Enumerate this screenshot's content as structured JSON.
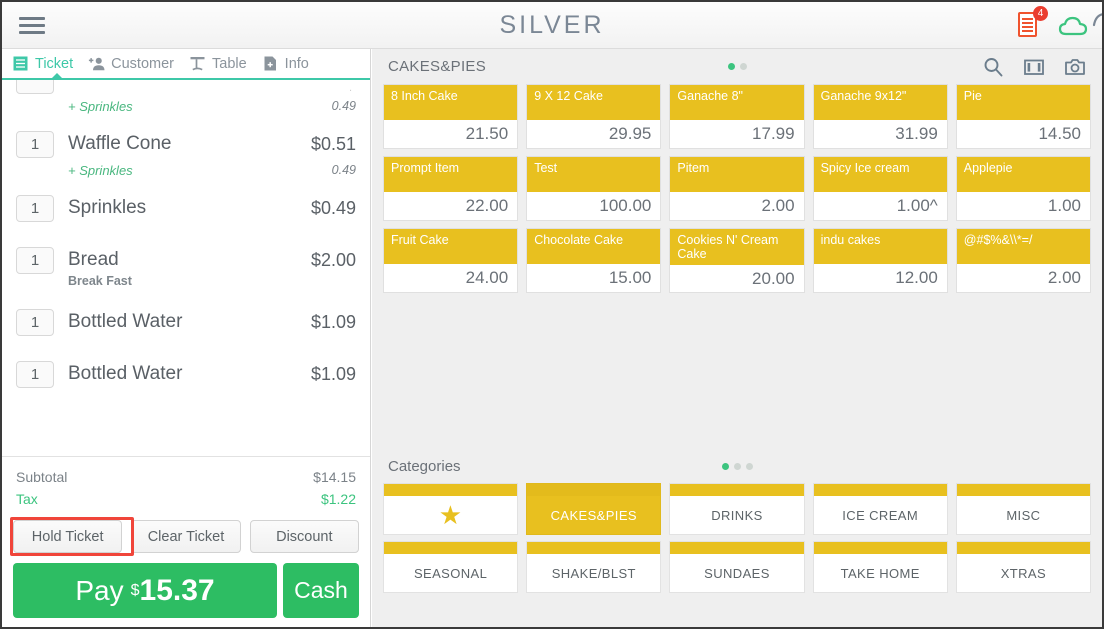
{
  "header": {
    "menu_icon": "hamburger-icon",
    "brand": "SILVER",
    "receipt_icon": "receipt-icon",
    "receipt_badge": "4",
    "cloud_icon": "cloud-icon",
    "accent_red": "#f0532e",
    "accent_green": "#3cc47f"
  },
  "ticket_panel": {
    "tabs": [
      {
        "label": "Ticket",
        "icon": "ticket-icon",
        "active": true
      },
      {
        "label": "Customer",
        "icon": "add-person-icon",
        "active": false
      },
      {
        "label": "Table",
        "icon": "table-icon",
        "active": false
      },
      {
        "label": "Info",
        "icon": "add-file-icon",
        "active": false
      }
    ],
    "clipped_modifier": {
      "name": "+ Sprinkles",
      "price": "0.49"
    },
    "items": [
      {
        "qty": "1",
        "name": "Waffle Cone",
        "price": "$0.51",
        "modifier": {
          "name": "+ Sprinkles",
          "price": "0.49"
        }
      },
      {
        "qty": "1",
        "name": "Sprinkles",
        "price": "$0.49"
      },
      {
        "qty": "1",
        "name": "Bread",
        "price": "$2.00",
        "sublabel": "Break Fast"
      },
      {
        "qty": "1",
        "name": "Bottled Water",
        "price": "$1.09"
      },
      {
        "qty": "1",
        "name": "Bottled Water",
        "price": "$1.09"
      }
    ],
    "totals": [
      {
        "label": "Subtotal",
        "value": "$14.15",
        "type": "subtotal"
      },
      {
        "label": "Tax",
        "value": "$1.22",
        "type": "tax"
      }
    ],
    "actions": [
      {
        "label": "Hold Ticket",
        "highlighted": true
      },
      {
        "label": "Clear Ticket",
        "highlighted": false
      },
      {
        "label": "Discount",
        "highlighted": false
      }
    ],
    "pay": {
      "label": "Pay",
      "currency": "$",
      "amount": "15.37"
    },
    "cash": {
      "label": "Cash"
    }
  },
  "product_grid": {
    "title": "CAKES&PIES",
    "pagination": {
      "count": 2,
      "active": 0
    },
    "icons": [
      {
        "name": "search-icon"
      },
      {
        "name": "columns-view-icon"
      },
      {
        "name": "camera-icon"
      }
    ],
    "tiles": [
      {
        "name": "8 Inch Cake",
        "price": "21.50"
      },
      {
        "name": "9 X 12 Cake",
        "price": "29.95"
      },
      {
        "name": "Ganache 8\"",
        "price": "17.99"
      },
      {
        "name": "Ganache 9x12\"",
        "price": "31.99"
      },
      {
        "name": "Pie",
        "price": "14.50"
      },
      {
        "name": "Prompt Item",
        "price": "22.00"
      },
      {
        "name": "Test",
        "price": "100.00"
      },
      {
        "name": "Pitem",
        "price": "2.00"
      },
      {
        "name": "Spicy Ice cream",
        "price": "1.00^"
      },
      {
        "name": "Applepie",
        "price": "1.00"
      },
      {
        "name": "Fruit Cake",
        "price": "24.00"
      },
      {
        "name": "Chocolate Cake",
        "price": "15.00"
      },
      {
        "name": "Cookies N' Cream Cake",
        "price": "20.00"
      },
      {
        "name": "indu cakes",
        "price": "12.00"
      },
      {
        "name": "@#$%&\\\\*=/",
        "price": "2.00"
      }
    ]
  },
  "categories": {
    "title": "Categories",
    "pagination": {
      "count": 3,
      "active": 0
    },
    "items": [
      {
        "label": "★",
        "is_star": true,
        "selected": false
      },
      {
        "label": "CAKES&PIES",
        "is_star": false,
        "selected": true
      },
      {
        "label": "DRINKS",
        "is_star": false,
        "selected": false
      },
      {
        "label": "ICE CREAM",
        "is_star": false,
        "selected": false
      },
      {
        "label": "MISC",
        "is_star": false,
        "selected": false
      },
      {
        "label": "SEASONAL",
        "is_star": false,
        "selected": false
      },
      {
        "label": "SHAKE/BLST",
        "is_star": false,
        "selected": false
      },
      {
        "label": "SUNDAES",
        "is_star": false,
        "selected": false
      },
      {
        "label": "TAKE HOME",
        "is_star": false,
        "selected": false
      },
      {
        "label": "XTRAS",
        "is_star": false,
        "selected": false
      }
    ]
  },
  "colors": {
    "tile_yellow": "#e8c01f",
    "pay_green": "#2dbd63",
    "tab_teal": "#3ec8a8",
    "highlight_red": "#f0453a"
  }
}
